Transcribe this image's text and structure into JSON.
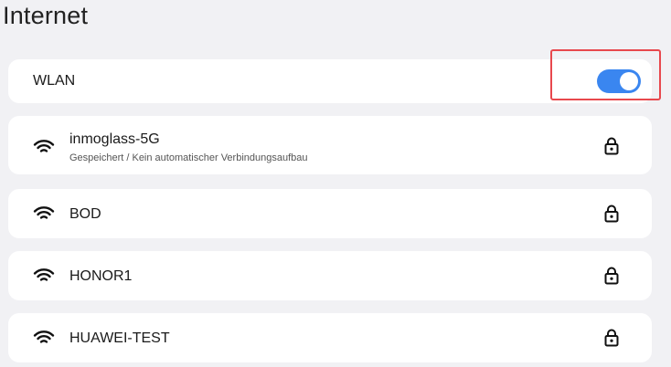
{
  "page": {
    "title": "Internet"
  },
  "wlan": {
    "label": "WLAN",
    "enabled": true,
    "toggle_color": "#3a86f0",
    "highlight_color": "#e8484d"
  },
  "networks": [
    {
      "ssid": "inmoglass-5G",
      "status": "Gespeichert / Kein automatischer Verbindungsaufbau",
      "signal_icon": "wifi-icon",
      "security_icon": "lock-icon"
    },
    {
      "ssid": "BOD",
      "status": "",
      "signal_icon": "wifi-icon",
      "security_icon": "lock-icon"
    },
    {
      "ssid": "HONOR1",
      "status": "",
      "signal_icon": "wifi-icon",
      "security_icon": "lock-icon"
    },
    {
      "ssid": "HUAWEI-TEST",
      "status": "",
      "signal_icon": "wifi-icon",
      "security_icon": "lock-icon"
    }
  ]
}
